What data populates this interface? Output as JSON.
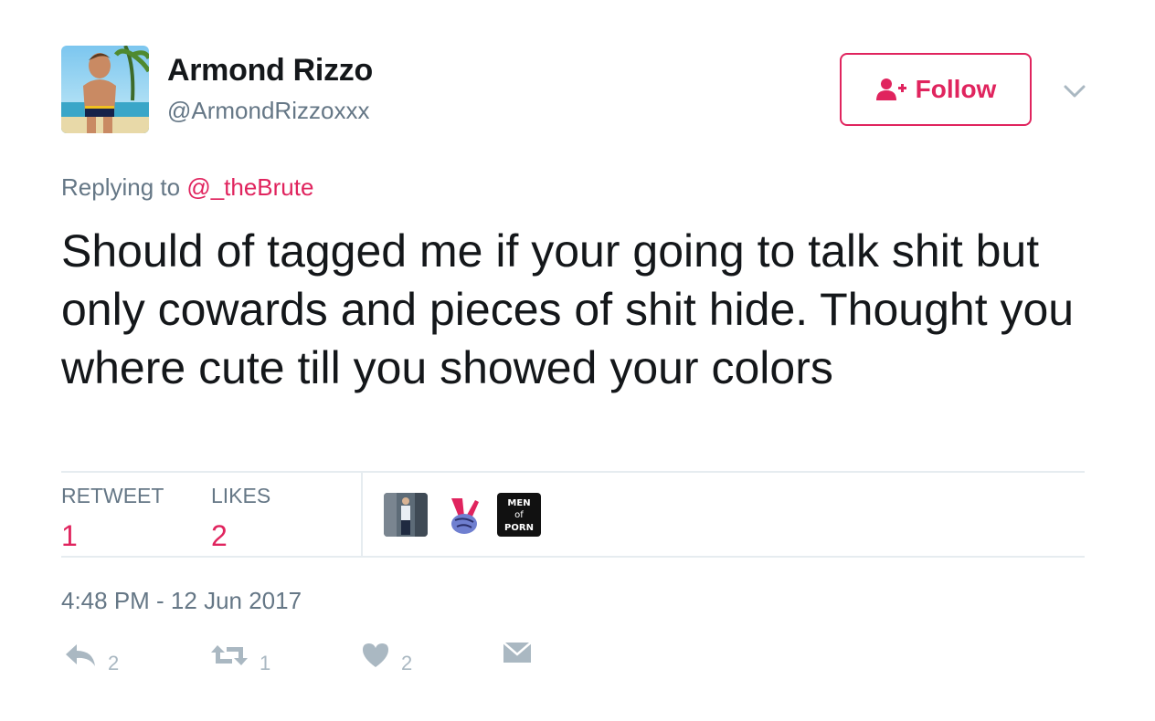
{
  "author": {
    "display_name": "Armond Rizzo",
    "screen_name": "@ArmondRizzoxxx"
  },
  "follow_button": {
    "label": "Follow"
  },
  "reply_context": {
    "prefix": "Replying to",
    "mention": "@_theBrute"
  },
  "tweet": {
    "text": "Should of tagged me if your going to talk shit but only cowards and pieces of shit hide. Thought you where cute till you showed your colors",
    "timestamp": "4:48 PM - 12 Jun 2017"
  },
  "stats": {
    "retweet_label": "RETWEET",
    "retweet_count": "1",
    "likes_label": "LIKES",
    "likes_count": "2"
  },
  "liker_avatars": [
    {
      "name": "person-photo"
    },
    {
      "name": "peace-hand-emoji"
    },
    {
      "name": "men-of-porn-logo",
      "text": [
        "MEN",
        "of",
        "PORN"
      ]
    }
  ],
  "actions": {
    "reply_count": "2",
    "retweet_count": "1",
    "like_count": "2"
  },
  "colors": {
    "accent": "#e0245e",
    "secondary_text": "#657786",
    "icon_gray": "#aab8c2",
    "divider": "#e6ecf0"
  }
}
